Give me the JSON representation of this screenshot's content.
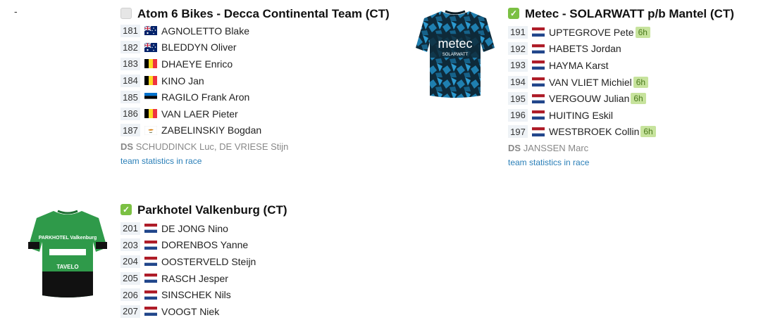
{
  "dash": "-",
  "teams": [
    {
      "name": "Atom 6 Bikes - Decca Continental Team (CT)",
      "status": "unchecked",
      "riders": [
        {
          "bib": "181",
          "flag": "au",
          "name": "AGNOLETTO Blake",
          "badge": ""
        },
        {
          "bib": "182",
          "flag": "au",
          "name": "BLEDDYN Oliver",
          "badge": ""
        },
        {
          "bib": "183",
          "flag": "be",
          "name": "DHAEYE Enrico",
          "badge": ""
        },
        {
          "bib": "184",
          "flag": "be",
          "name": "KINO Jan",
          "badge": ""
        },
        {
          "bib": "185",
          "flag": "ee",
          "name": "RAGILO Frank Aron",
          "badge": ""
        },
        {
          "bib": "186",
          "flag": "be",
          "name": "VAN LAER Pieter",
          "badge": ""
        },
        {
          "bib": "187",
          "flag": "cy",
          "name": "ZABELINSKIY Bogdan",
          "badge": ""
        }
      ],
      "ds_label": "DS",
      "ds_names": "SCHUDDINCK Luc, DE VRIESE Stijn",
      "stats_link": "team statistics in race"
    },
    {
      "name": "Metec - SOLARWATT p/b Mantel (CT)",
      "status": "checked",
      "riders": [
        {
          "bib": "191",
          "flag": "nl",
          "name": "UPTEGROVE Pete",
          "badge": "6h"
        },
        {
          "bib": "192",
          "flag": "nl",
          "name": "HABETS Jordan",
          "badge": ""
        },
        {
          "bib": "193",
          "flag": "nl",
          "name": "HAYMA Karst",
          "badge": ""
        },
        {
          "bib": "194",
          "flag": "nl",
          "name": "VAN VLIET Michiel",
          "badge": "6h"
        },
        {
          "bib": "195",
          "flag": "nl",
          "name": "VERGOUW Julian",
          "badge": "6h"
        },
        {
          "bib": "196",
          "flag": "nl",
          "name": "HUITING Eskil",
          "badge": ""
        },
        {
          "bib": "197",
          "flag": "nl",
          "name": "WESTBROEK Collin",
          "badge": "6h"
        }
      ],
      "ds_label": "DS",
      "ds_names": "JANSSEN Marc",
      "stats_link": "team statistics in race",
      "jersey_text": "metec",
      "jersey_subtext": "SOLARWATT"
    },
    {
      "name": "Parkhotel Valkenburg (CT)",
      "status": "checked",
      "riders": [
        {
          "bib": "201",
          "flag": "nl",
          "name": "DE JONG Nino",
          "badge": ""
        },
        {
          "bib": "203",
          "flag": "nl",
          "name": "DORENBOS Yanne",
          "badge": ""
        },
        {
          "bib": "204",
          "flag": "nl",
          "name": "OOSTERVELD Steijn",
          "badge": ""
        },
        {
          "bib": "205",
          "flag": "nl",
          "name": "RASCH Jesper",
          "badge": ""
        },
        {
          "bib": "206",
          "flag": "nl",
          "name": "SINSCHEK Nils",
          "badge": ""
        },
        {
          "bib": "207",
          "flag": "nl",
          "name": "VOOGT Niek",
          "badge": ""
        }
      ],
      "jersey_text": "PARKHOTEL Valkenburg",
      "jersey_subtext": "TAVELO"
    }
  ],
  "colors": {
    "check": "#7bc043",
    "link": "#2a7fb8",
    "badge_bg": "#c7e39d",
    "bib_bg": "#eef2f6"
  }
}
